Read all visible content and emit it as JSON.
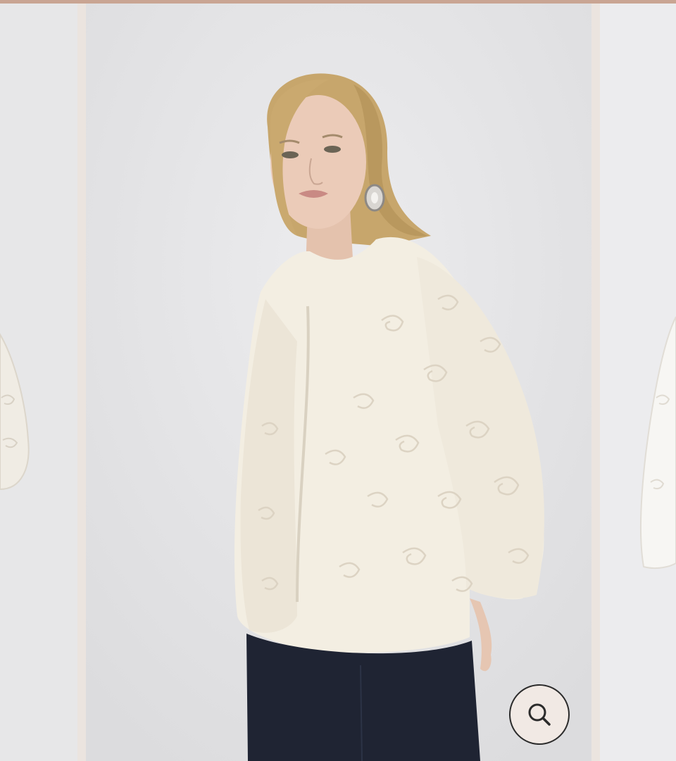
{
  "gallery": {
    "slides": [
      {
        "name": "previous-image",
        "state": "partial"
      },
      {
        "name": "current-image",
        "state": "active"
      },
      {
        "name": "next-image",
        "state": "partial"
      }
    ],
    "product": {
      "description_colors": {
        "jacket": "#f3eee2",
        "pants": "#1f2433",
        "hair": "#c9a86a",
        "skin": "#e9c9b5",
        "background": "#e3e3e5"
      }
    },
    "zoom_button": {
      "icon": "magnifier-icon",
      "background": "#f1e9e4",
      "border": "#2b2b2b"
    }
  },
  "top_bar": {
    "color": "#c9a593"
  }
}
